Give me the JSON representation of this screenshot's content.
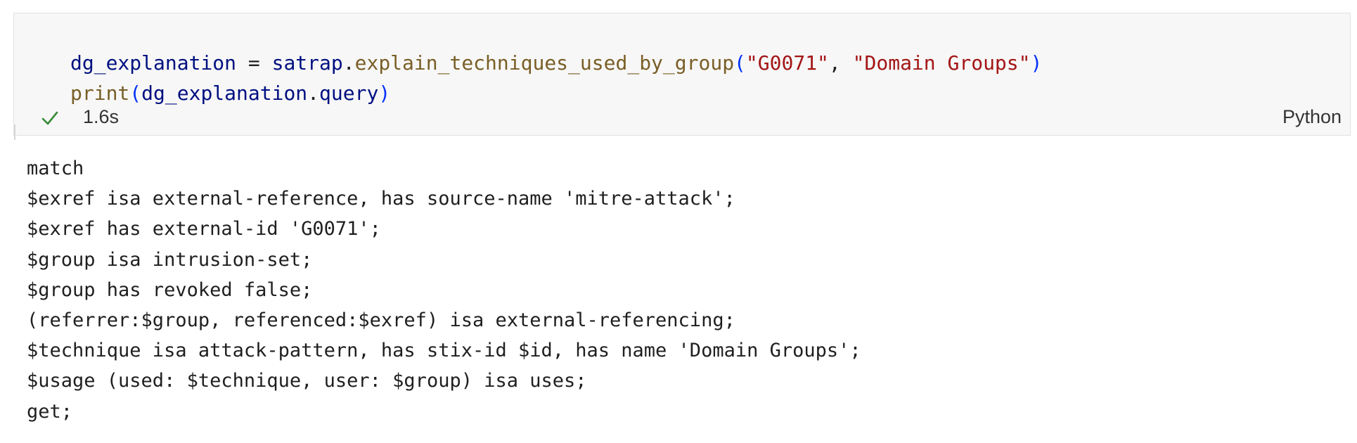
{
  "cell": {
    "code_lines": [
      [
        {
          "t": "var",
          "v": "dg_explanation"
        },
        {
          "t": "op",
          "v": " = "
        },
        {
          "t": "var",
          "v": "satrap"
        },
        {
          "t": "op",
          "v": "."
        },
        {
          "t": "fn",
          "v": "explain_techniques_used_by_group"
        },
        {
          "t": "paren",
          "v": "("
        },
        {
          "t": "str",
          "v": "\"G0071\""
        },
        {
          "t": "op",
          "v": ", "
        },
        {
          "t": "str",
          "v": "\"Domain Groups\""
        },
        {
          "t": "paren",
          "v": ")"
        }
      ],
      [
        {
          "t": "fn",
          "v": "print"
        },
        {
          "t": "paren",
          "v": "("
        },
        {
          "t": "var",
          "v": "dg_explanation"
        },
        {
          "t": "op",
          "v": "."
        },
        {
          "t": "var",
          "v": "query"
        },
        {
          "t": "paren",
          "v": ")"
        }
      ]
    ],
    "status": {
      "icon": "check-icon",
      "exec_time": "1.6s",
      "kernel": "Python",
      "success_color": "#388a34"
    }
  },
  "output": {
    "lines": [
      "match",
      "$exref isa external-reference, has source-name 'mitre-attack';",
      "$exref has external-id 'G0071';",
      "$group isa intrusion-set;",
      "$group has revoked false;",
      "(referrer:$group, referenced:$exref) isa external-referencing;",
      "$technique isa attack-pattern, has stix-id $id, has name 'Domain Groups';",
      "$usage (used: $technique, user: $group) isa uses;",
      "get;"
    ]
  },
  "colors": {
    "cell_background": "#f7f7f7",
    "variable": "#001080",
    "function": "#795e26",
    "string": "#a31515",
    "paren": "#0431fa"
  }
}
